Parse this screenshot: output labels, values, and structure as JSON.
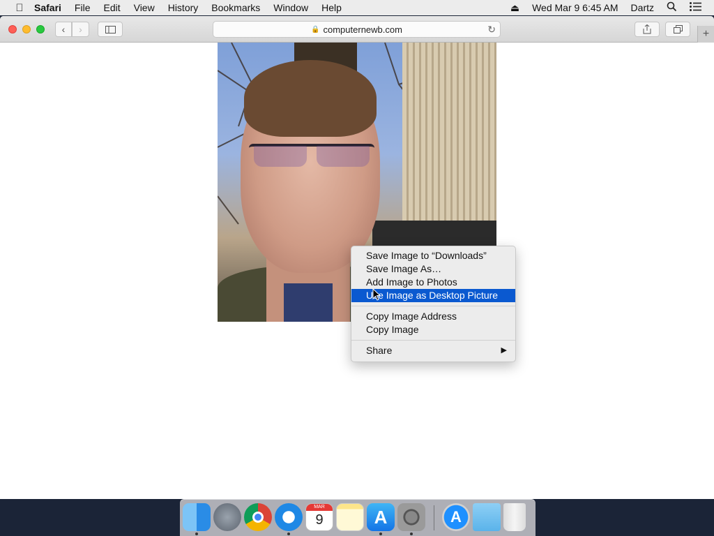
{
  "menubar": {
    "apple": "",
    "items": [
      "Safari",
      "File",
      "Edit",
      "View",
      "History",
      "Bookmarks",
      "Window",
      "Help"
    ],
    "datetime": "Wed Mar 9  6:45 AM",
    "user": "Dartz"
  },
  "browser": {
    "url": "computernewb.com"
  },
  "context_menu": {
    "items": [
      {
        "label": "Save Image to “Downloads”"
      },
      {
        "label": "Save Image As…"
      },
      {
        "label": "Add Image to Photos"
      },
      {
        "label": "Use Image as Desktop Picture",
        "selected": true
      },
      {
        "label": "Copy Image Address"
      },
      {
        "label": "Copy Image"
      },
      {
        "label": "Share",
        "submenu": true
      }
    ]
  },
  "dock": {
    "apps": [
      "Finder",
      "Launchpad",
      "Google Chrome",
      "Safari",
      "Calendar",
      "Notes",
      "App Store",
      "System Preferences",
      "Downloads",
      "Downloads Folder",
      "Trash"
    ],
    "calendar_month": "MAR",
    "calendar_day": "9"
  },
  "colors": {
    "menu_highlight": "#0a59d0",
    "desktop": "#1b2437"
  }
}
